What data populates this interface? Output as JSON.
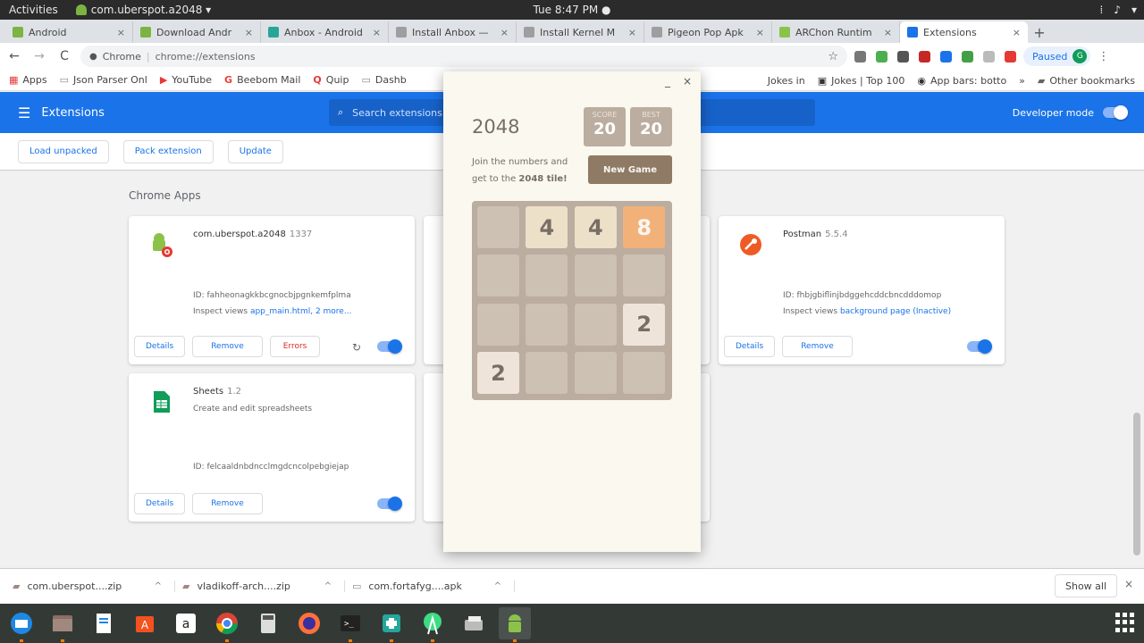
{
  "topbar": {
    "activities": "Activities",
    "app_name": "com.uberspot.a2048 ▾",
    "clock": "Tue  8:47 PM ●",
    "tray_network": "⁞",
    "tray_volume": "♪",
    "tray_menu": "▾"
  },
  "tabs": [
    {
      "label": "Android",
      "favicon_color": "#7cb342",
      "active": false
    },
    {
      "label": "Download Andr",
      "favicon_color": "#7cb342",
      "active": false
    },
    {
      "label": "Anbox - Android",
      "favicon_color": "#26a69a",
      "active": false
    },
    {
      "label": "Install Anbox —",
      "favicon_color": "#9e9e9e",
      "active": false
    },
    {
      "label": "Install Kernel M",
      "favicon_color": "#9e9e9e",
      "active": false
    },
    {
      "label": "Pigeon Pop Apk",
      "favicon_color": "#9e9e9e",
      "active": false
    },
    {
      "label": "ARChon Runtim",
      "favicon_color": "#8bc34a",
      "active": false
    },
    {
      "label": "Extensions",
      "favicon_color": "#1a73e8",
      "active": true
    }
  ],
  "toolbar": {
    "back": "←",
    "forward": "→",
    "reload": "C",
    "site_label": "Chrome",
    "url": "chrome://extensions",
    "star": "☆",
    "paused_label": "Paused",
    "avatar_letter": "G"
  },
  "ext_icon_colors": [
    "#777777",
    "#4caf50",
    "#555555",
    "#c62828",
    "#1a73e8",
    "#43a047",
    "#bbbbbb",
    "#e53935"
  ],
  "bookmarks": {
    "left": [
      "Apps",
      "Json Parser Onl",
      "YouTube",
      "Beebom Mail",
      "Quip",
      "Dashb"
    ],
    "right": [
      "Jokes in",
      "Jokes | Top 100",
      "App bars: botto",
      "»",
      "Other bookmarks"
    ]
  },
  "extensions_header": {
    "menu_icon": "☰",
    "title": "Extensions",
    "search_placeholder": "Search extensions",
    "developer_mode": "Developer mode"
  },
  "actions": [
    "Load unpacked",
    "Pack extension",
    "Update"
  ],
  "section_title": "Chrome Apps",
  "cards": [
    {
      "name": "com.uberspot.a2048",
      "version": "1337",
      "description": "",
      "id": "ID: fahheonagkkbcgnocbjpgnkemfplma",
      "inspect_label": "Inspect views",
      "inspect_link": "app_main.html, 2 more...",
      "buttons": [
        "Details",
        "Remove",
        "Errors"
      ],
      "reload_icon": "↻"
    },
    {
      "name": "Postman",
      "version": "5.5.4",
      "description": "",
      "id": "ID: fhbjgbiflinjbdggehcddcbncdddomop",
      "inspect_label": "Inspect views",
      "inspect_link": "background page (Inactive)",
      "buttons": [
        "Details",
        "Remove"
      ]
    },
    {
      "name": "Sheets",
      "version": "1.2",
      "description": "Create and edit spreadsheets",
      "id": "ID: felcaaldnbdncclmgdcncolpebgiejap",
      "buttons": [
        "Details",
        "Remove"
      ]
    }
  ],
  "popup": {
    "minimize": "_",
    "close": "×",
    "game_title": "2048",
    "score_label": "SCORE",
    "score_value": "20",
    "best_label": "BEST",
    "best_value": "20",
    "intro_text": "Join the numbers and get to the",
    "intro_bold": "2048 tile!",
    "new_game": "New Game",
    "grid": [
      [
        0,
        4,
        4,
        8
      ],
      [
        0,
        0,
        0,
        0
      ],
      [
        0,
        0,
        0,
        2
      ],
      [
        2,
        0,
        0,
        0
      ]
    ]
  },
  "downloads": {
    "items": [
      "com.uberspot....zip",
      "vladikoff-arch....zip",
      "com.fortafyg....apk"
    ],
    "show_all": "Show all",
    "close": "×"
  },
  "dock": {
    "apps": [
      "thunderbird",
      "files",
      "writer",
      "software",
      "amazon",
      "chrome",
      "calculator",
      "firefox",
      "terminal",
      "anbox",
      "android-studio",
      "scanner",
      "android"
    ]
  }
}
